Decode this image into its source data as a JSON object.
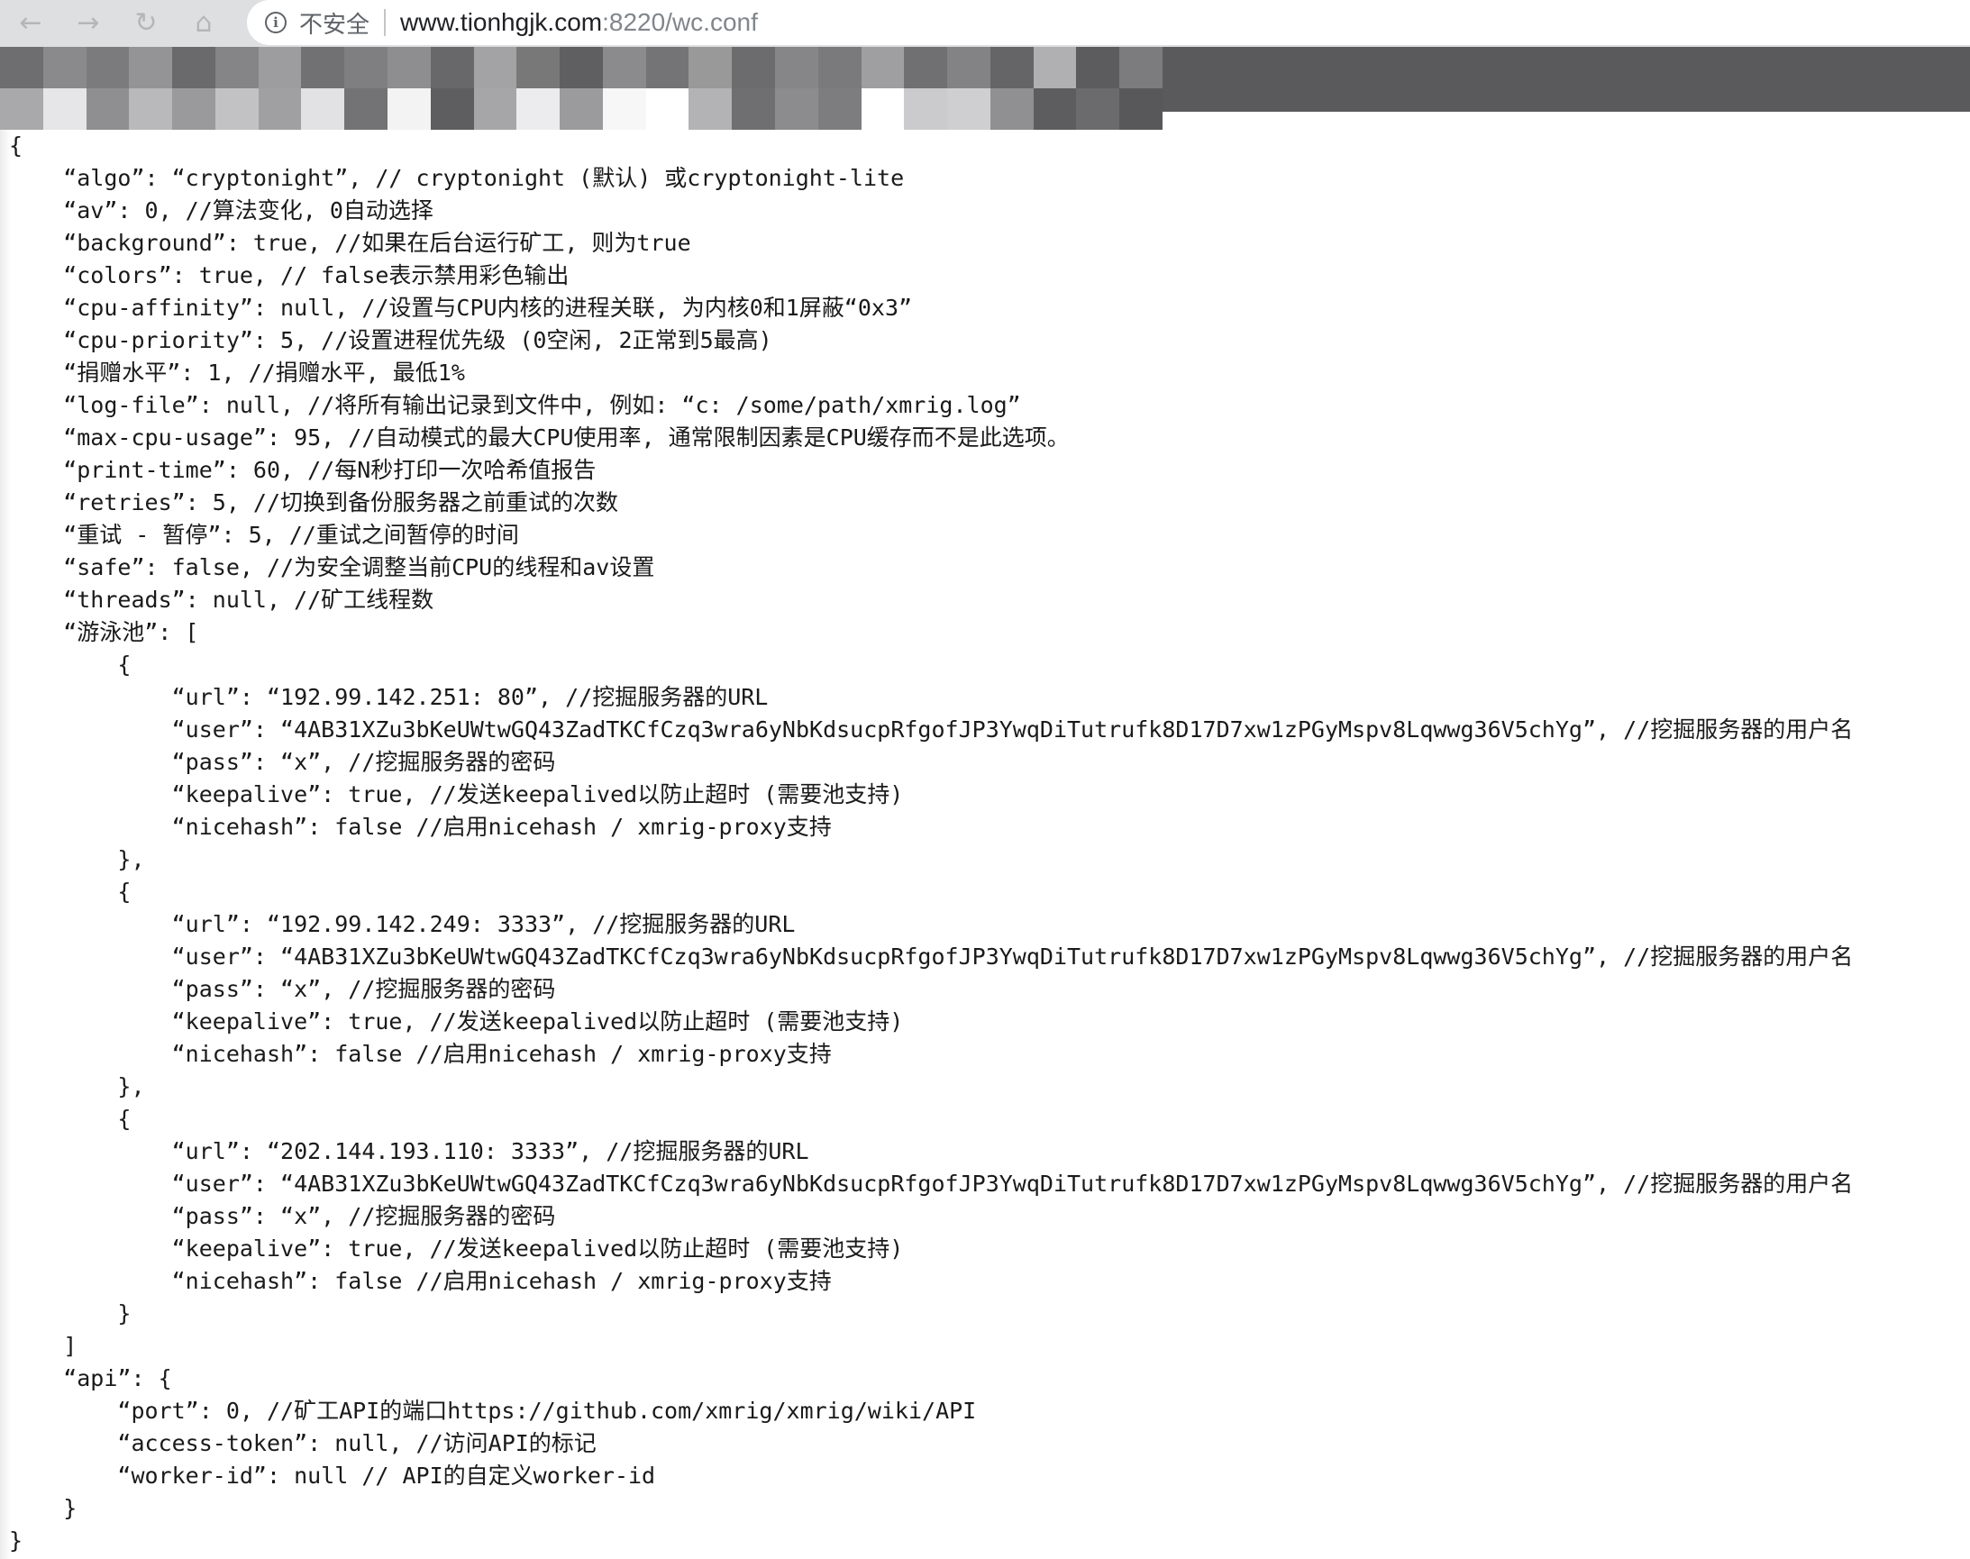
{
  "browser": {
    "security_label": "不安全",
    "url_host": "www.tionhgjk.com",
    "url_rest": ":8220/wc.conf",
    "icons": {
      "back": "arrow-left-icon",
      "forward": "arrow-right-icon",
      "reload": "reload-icon",
      "home": "home-icon",
      "info": "info-icon"
    }
  },
  "colors": {
    "toolbar": "#dedfe1",
    "banner": "#5a5a5c",
    "text": "#1a1a1a",
    "url_secondary": "#80868b"
  },
  "document": {
    "lines": [
      "{",
      "    “algo”: “cryptonight”, // cryptonight (默认) 或cryptonight-lite",
      "    “av”: 0, //算法变化, 0自动选择",
      "    “background”: true, //如果在后台运行矿工, 则为true",
      "    “colors”: true, // false表示禁用彩色输出",
      "    “cpu-affinity”: null, //设置与CPU内核的进程关联, 为内核0和1屏蔽“0x3”",
      "    “cpu-priority”: 5, //设置进程优先级 (0空闲, 2正常到5最高)",
      "    “捐赠水平”: 1, //捐赠水平, 最低1%",
      "    “log-file”: null, //将所有输出记录到文件中, 例如: “c: /some/path/xmrig.log”",
      "    “max-cpu-usage”: 95, //自动模式的最大CPU使用率, 通常限制因素是CPU缓存而不是此选项。",
      "    “print-time”: 60, //每N秒打印一次哈希值报告",
      "    “retries”: 5, //切换到备份服务器之前重试的次数",
      "    “重试 - 暂停”: 5, //重试之间暂停的时间",
      "    “safe”: false, //为安全调整当前CPU的线程和av设置",
      "    “threads”: null, //矿工线程数",
      "    “游泳池”: [",
      "        {",
      "            “url”: “192.99.142.251: 80”, //挖掘服务器的URL",
      "            “user”: “4AB31XZu3bKeUWtwGQ43ZadTKCfCzq3wra6yNbKdsucpRfgofJP3YwqDiTutrufk8D17D7xw1zPGyMspv8Lqwwg36V5chYg”, //挖掘服务器的用户名",
      "            “pass”: “x”, //挖掘服务器的密码",
      "            “keepalive”: true, //发送keepalived以防止超时 (需要池支持)",
      "            “nicehash”: false //启用nicehash / xmrig-proxy支持",
      "        },",
      "        {",
      "            “url”: “192.99.142.249: 3333”, //挖掘服务器的URL",
      "            “user”: “4AB31XZu3bKeUWtwGQ43ZadTKCfCzq3wra6yNbKdsucpRfgofJP3YwqDiTutrufk8D17D7xw1zPGyMspv8Lqwwg36V5chYg”, //挖掘服务器的用户名",
      "            “pass”: “x”, //挖掘服务器的密码",
      "            “keepalive”: true, //发送keepalived以防止超时 (需要池支持)",
      "            “nicehash”: false //启用nicehash / xmrig-proxy支持",
      "        },",
      "        {",
      "            “url”: “202.144.193.110: 3333”, //挖掘服务器的URL",
      "            “user”: “4AB31XZu3bKeUWtwGQ43ZadTKCfCzq3wra6yNbKdsucpRfgofJP3YwqDiTutrufk8D17D7xw1zPGyMspv8Lqwwg36V5chYg”, //挖掘服务器的用户名",
      "            “pass”: “x”, //挖掘服务器的密码",
      "            “keepalive”: true, //发送keepalived以防止超时 (需要池支持)",
      "            “nicehash”: false //启用nicehash / xmrig-proxy支持",
      "        }",
      "    ]",
      "    “api”: {",
      "        “port”: 0, //矿工API的端口https://github.com/xmrig/xmrig/wiki/API",
      "        “access-token”: null, //访问API的标记",
      "        “worker-id”: null // API的自定义worker-id",
      "    }",
      "}"
    ]
  }
}
